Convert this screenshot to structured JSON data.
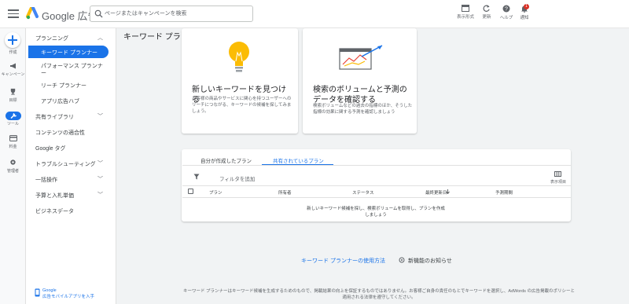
{
  "header": {
    "brand": "Google 広告",
    "search_placeholder": "ページまたはキャンペーンを検索",
    "buttons": [
      {
        "label": "表示形式",
        "icon": "appearance-icon"
      },
      {
        "label": "更新",
        "icon": "refresh-icon"
      },
      {
        "label": "ヘルプ",
        "icon": "help-icon"
      },
      {
        "label": "通知",
        "icon": "bell-icon"
      }
    ],
    "notification_count": "1"
  },
  "rail": {
    "create": "作成",
    "items": [
      "キャンペーン",
      "目標",
      "ツール",
      "料金",
      "管理者"
    ]
  },
  "nav": {
    "planning": "プランニング",
    "keyword_planner": "キーワード プランナー",
    "performance_planner": "パフォーマンス プランナー",
    "reach_planner": "リーチ プランナー",
    "app_ad_hub": "アプリ広告ハブ",
    "shared_library": "共有ライブラリ",
    "content_suitability": "コンテンツの適合性",
    "google_tag": "Google タグ",
    "troubleshooting": "トラブルシューティング",
    "bulk_actions": "一括操作",
    "budgets_bidding": "予算と入札単価",
    "business_data": "ビジネスデータ",
    "footer_line1": "Google",
    "footer_line2": "広告モバイルアプリを入手"
  },
  "main": {
    "title": "キーワード プランナー",
    "card1": {
      "title": "新しいキーワードを見つける",
      "desc": "お客様の商品やサービスに関心を持つユーザーへのリーチにつながる、キーワードの候補を探してみましょう。"
    },
    "card2": {
      "title": "検索のボリュームと予測のデータを確認する",
      "desc": "検索ボリュームなどの過去の指標のほか、そうした指標の効果に関する予測を確認しましょう"
    },
    "tabs": [
      "自分が作成したプラン",
      "共有されているプラン"
    ],
    "filter": "フィルタを追加",
    "columns_label": "表示項目",
    "columns": [
      "プラン",
      "所有者",
      "ステータス",
      "最終更新日",
      "予測期間"
    ],
    "empty_text": "新しいキーワード候補を探し、検索ボリュームを取得し、プランを作成しましょう",
    "link_howto": "キーワード プランナーの使用方法",
    "link_whatsnew": "新機能のお知らせ",
    "footer": "キーワード プランナーはキーワード候補を生成するためのもので、掲載結果の向上を保証するものではありません。お客様ご自身の責任のもとでキーワードを選択し、AdWords の広告掲載のポリシーと適用される法律を遵守してください。"
  },
  "colors": {
    "accent": "#1a73e8",
    "bulb": "#fbbc04"
  }
}
